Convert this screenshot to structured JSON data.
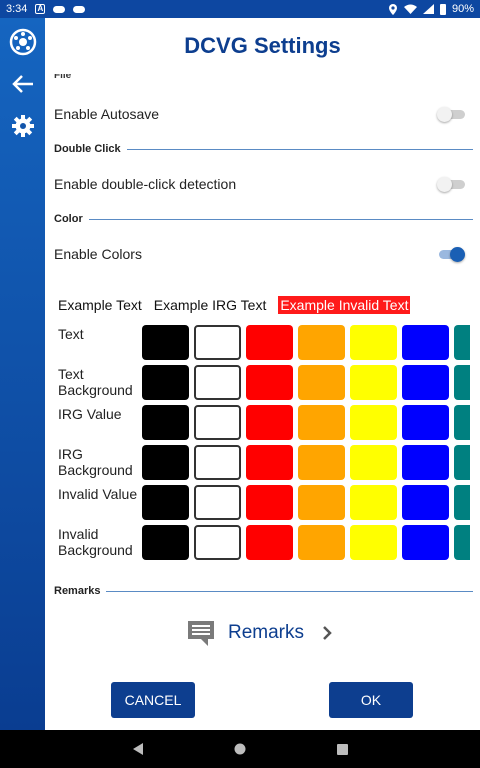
{
  "status_bar": {
    "time": "3:34",
    "battery": "90%"
  },
  "header": {
    "title": "DCVG Settings"
  },
  "sections": {
    "file_cut": "File",
    "autosave": {
      "label": "Enable Autosave",
      "enabled": false
    },
    "double_click": {
      "title": "Double Click",
      "label": "Enable double-click detection",
      "enabled": false
    },
    "color": {
      "title": "Color",
      "label": "Enable Colors",
      "enabled": true
    },
    "remarks": {
      "title": "Remarks"
    }
  },
  "examples": {
    "text": "Example Text",
    "irg": "Example IRG Text",
    "invalid": "Example Invalid Text",
    "invalid_bg": "#ff1a1a"
  },
  "color_rows": [
    {
      "label": "Text"
    },
    {
      "label": "Text Background"
    },
    {
      "label": "IRG Value"
    },
    {
      "label": "IRG Background"
    },
    {
      "label": "Invalid Value"
    },
    {
      "label": "Invalid Background"
    }
  ],
  "palette": [
    "#000000",
    "#ffffff",
    "#ff0000",
    "#ffa500",
    "#ffff00",
    "#0000ff",
    "#008080"
  ],
  "remarks_link": {
    "label": "Remarks"
  },
  "buttons": {
    "cancel": "CANCEL",
    "ok": "OK"
  },
  "colors": {
    "accent": "#0d3e8f",
    "rail_top": "#1565c0",
    "rail_bottom": "#0a3d91"
  }
}
